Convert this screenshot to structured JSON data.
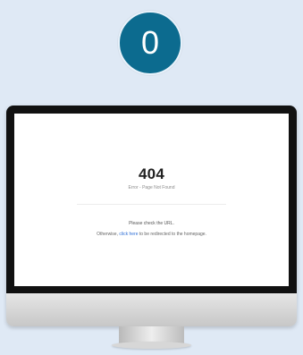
{
  "step_badge": {
    "value": "0"
  },
  "monitor": {
    "page": {
      "code": "404",
      "subtitle": "Error - Page Not Found",
      "help_text": "Please check the URL.",
      "redirect_prefix": "Otherwise, ",
      "redirect_link": "click here",
      "redirect_suffix": " to be redirected to the homepage."
    }
  },
  "colors": {
    "background": "#dfe9f5",
    "badge": "#0c6b8f",
    "link": "#2f6fd6"
  }
}
